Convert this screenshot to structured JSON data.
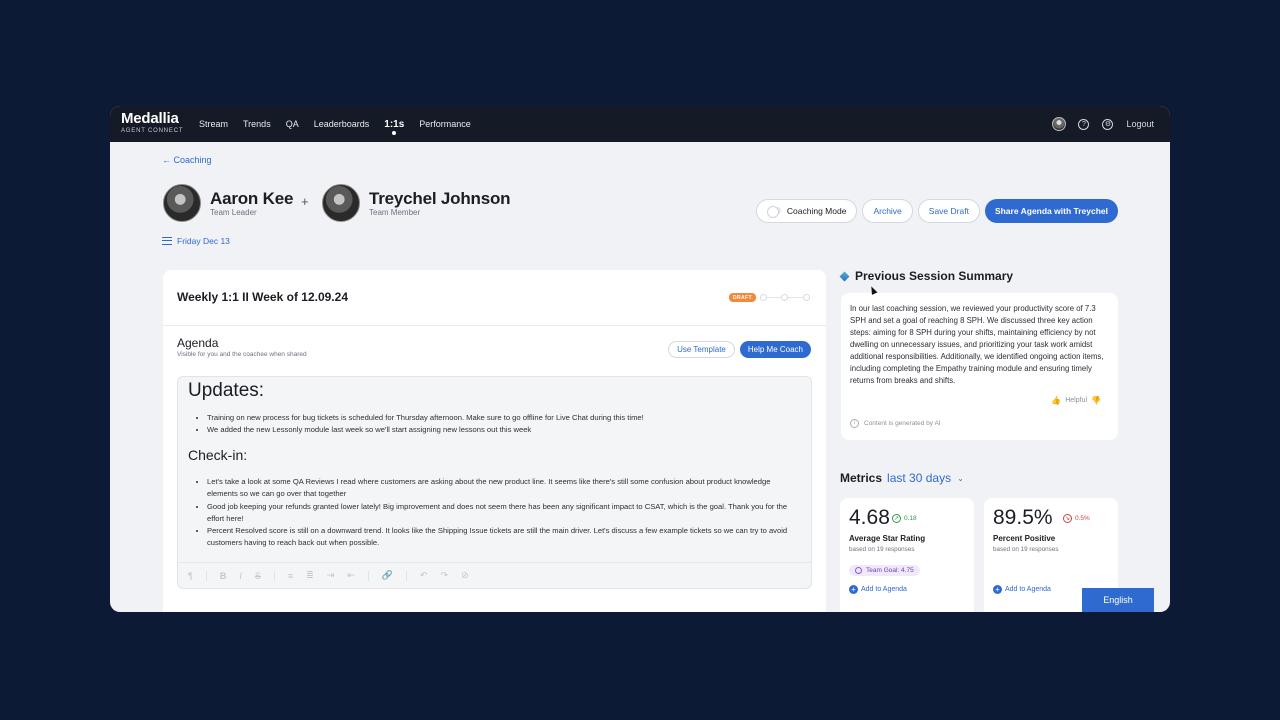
{
  "brand": {
    "name": "Medallia",
    "product": "AGENT CONNECT"
  },
  "nav": {
    "links": [
      "Stream",
      "Trends",
      "QA",
      "Leaderboards",
      "1:1s",
      "Performance"
    ],
    "active": "1:1s",
    "logout": "Logout"
  },
  "header": {
    "back_label": "← Coaching",
    "leader": {
      "name": "Aaron Kee",
      "role": "Team Leader"
    },
    "plus": "+",
    "member": {
      "name": "Treychel Johnson",
      "role": "Team Member"
    },
    "date": "Friday Dec 13",
    "coaching_mode": "Coaching Mode",
    "archive": "Archive",
    "save_draft": "Save Draft",
    "share": "Share Agenda with Treychel"
  },
  "session": {
    "title": "Weekly 1:1 II Week of 12.09.24",
    "status": "DRAFT"
  },
  "agenda": {
    "heading": "Agenda",
    "subtitle": "Visible for you and the coachee when shared",
    "use_template": "Use Template",
    "help_coach": "Help Me Coach",
    "updates_heading": "Updates:",
    "updates": [
      "Training on new process for bug tickets is scheduled for Thursday afternoon. Make sure to go offline for Live Chat during this time!",
      "We added the new Lessonly module last week so we'll start assigning new lessons out this week"
    ],
    "checkin_heading": "Check-in:",
    "checkin": [
      "Let's take a look at some QA Reviews I read where customers are asking about the new product line. It seems like there's still some confusion about product knowledge elements so we can go over that together",
      "Good job keeping your refunds granted lower lately! Big improvement and does not seem there has been any significant impact to CSAT, which is the goal. Thank you for the effort here!",
      "Percent Resolved score is still on a downward trend. It looks like the Shipping Issue tickets are still the main driver. Let's discuss a few example tickets so we can try to avoid customers having to reach back out when possible."
    ],
    "toolbar": [
      "¶",
      "B",
      "I",
      "S",
      "≡",
      "≣",
      "⇥",
      "⇤",
      "🔗",
      "↶",
      "↷",
      "⊘"
    ]
  },
  "summary": {
    "title": "Previous Session Summary",
    "text": "In our last coaching session, we reviewed your productivity score of 7.3 SPH and set a goal of reaching 8 SPH. We discussed three key action steps: aiming for 8 SPH during your shifts, maintaining efficiency by not dwelling on unnecessary issues, and prioritizing your task work amidst additional responsibilities. Additionally, we identified ongoing action items, including completing the Empathy training module and ensuring timely returns from breaks and shifts.",
    "helpful": "Helpful",
    "ai_note": "Content is generated by AI"
  },
  "metrics": {
    "title": "Metrics",
    "range": "last 30 days",
    "cards": [
      {
        "value": "4.68",
        "delta": "0.18",
        "label": "Average Star Rating",
        "sub": "based on 19 responses",
        "goal": "Team Goal: 4.75",
        "add": "Add to Agenda"
      },
      {
        "value": "89.5%",
        "delta": "0.5%",
        "label": "Percent Positive",
        "sub": "based on 19 responses",
        "add": "Add to Agenda"
      }
    ]
  },
  "language": "English",
  "colors": {
    "accent": "#2f6ad0",
    "nav_bg": "#141a26",
    "page_bg": "#0c1a35",
    "draft": "#f08a3c"
  }
}
